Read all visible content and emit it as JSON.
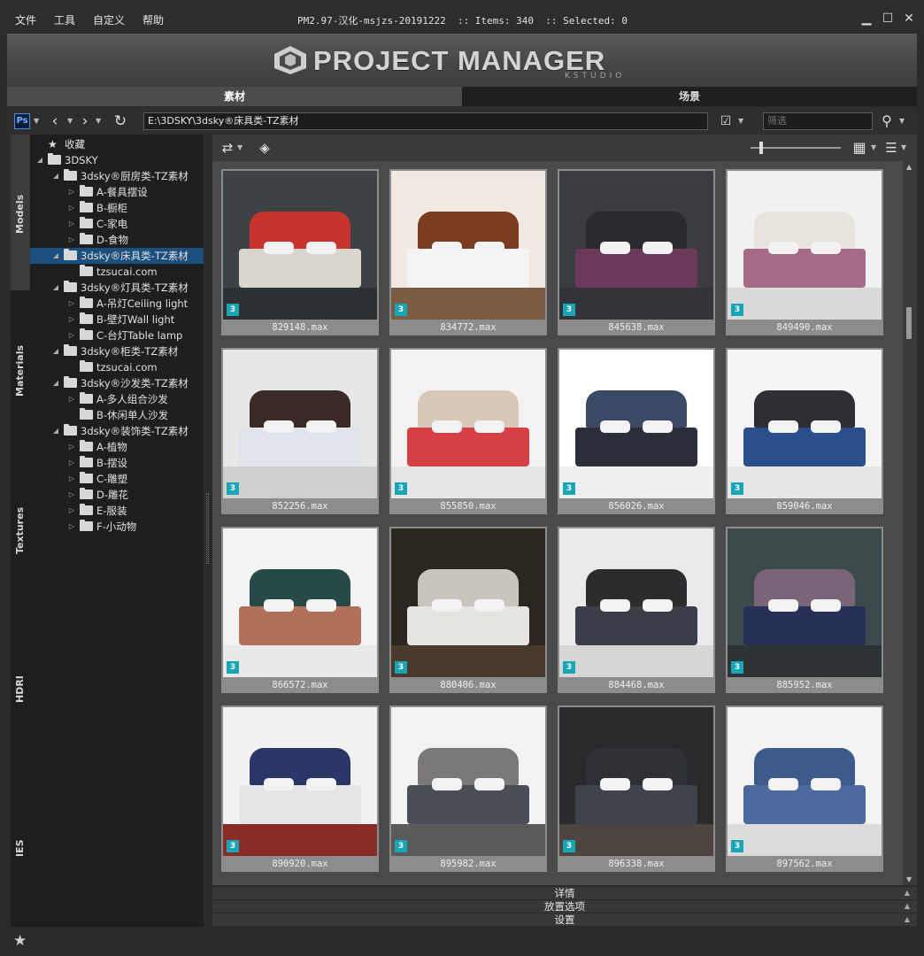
{
  "menu": [
    "文件",
    "工具",
    "自定义",
    "帮助"
  ],
  "title": "PM2.97-汉化-msjzs-20191222  :: Items: 340  :: Selected: 0",
  "logo": {
    "text": "PROJECT MANAGER",
    "sub": "KSTUDIO"
  },
  "main_tabs": [
    "素材",
    "场景"
  ],
  "toolbar": {
    "path": "E:\\3DSKY\\3dsky®床具类-TZ素材",
    "filter_placeholder": "筛选"
  },
  "side_tabs": [
    "Models",
    "Materials",
    "Textures",
    "HDRI",
    "IES"
  ],
  "tree": [
    {
      "label": "收藏",
      "level": 0,
      "tw": "",
      "star": true
    },
    {
      "label": "3DSKY",
      "level": 0,
      "tw": "◢"
    },
    {
      "label": "3dsky®厨房类-TZ素材",
      "level": 1,
      "tw": "◢"
    },
    {
      "label": "A-餐具摆设",
      "level": 2,
      "tw": "▷"
    },
    {
      "label": "B-橱柜",
      "level": 2,
      "tw": "▷"
    },
    {
      "label": "C-家电",
      "level": 2,
      "tw": "▷"
    },
    {
      "label": "D-食物",
      "level": 2,
      "tw": "▷"
    },
    {
      "label": "3dsky®床具类-TZ素材",
      "level": 1,
      "tw": "◢",
      "selected": true
    },
    {
      "label": "tzsucai.com",
      "level": 2,
      "tw": ""
    },
    {
      "label": "3dsky®灯具类-TZ素材",
      "level": 1,
      "tw": "◢"
    },
    {
      "label": "A-吊灯Ceiling light",
      "level": 2,
      "tw": "▷"
    },
    {
      "label": "B-壁灯Wall light",
      "level": 2,
      "tw": "▷"
    },
    {
      "label": "C-台灯Table lamp",
      "level": 2,
      "tw": "▷"
    },
    {
      "label": "3dsky®柜类-TZ素材",
      "level": 1,
      "tw": "◢"
    },
    {
      "label": "tzsucai.com",
      "level": 2,
      "tw": ""
    },
    {
      "label": "3dsky®沙发类-TZ素材",
      "level": 1,
      "tw": "◢"
    },
    {
      "label": "A-多人组合沙发",
      "level": 2,
      "tw": "▷"
    },
    {
      "label": "B-休闲单人沙发",
      "level": 2,
      "tw": ""
    },
    {
      "label": "3dsky®装饰类-TZ素材",
      "level": 1,
      "tw": "◢"
    },
    {
      "label": "A-植物",
      "level": 2,
      "tw": "▷"
    },
    {
      "label": "B-摆设",
      "level": 2,
      "tw": "▷"
    },
    {
      "label": "C-雕塑",
      "level": 2,
      "tw": "▷"
    },
    {
      "label": "D-雕花",
      "level": 2,
      "tw": "▷"
    },
    {
      "label": "E-服装",
      "level": 2,
      "tw": "▷"
    },
    {
      "label": "F-小动物",
      "level": 2,
      "tw": "▷"
    }
  ],
  "items": [
    {
      "file": "829148.max",
      "wall": "#3d4245",
      "head": "#c8332d",
      "bed": "#d9d4cc",
      "floor": "#2e3134"
    },
    {
      "file": "834772.max",
      "wall": "#efe9e2",
      "head": "#7a3b1f",
      "bed": "#f4f4f4",
      "floor": "#7a5b43"
    },
    {
      "file": "845638.max",
      "wall": "#3b3c40",
      "head": "#2a2a2e",
      "bed": "#6b3a5a",
      "floor": "#33343a"
    },
    {
      "file": "849490.max",
      "wall": "#f1f1f1",
      "head": "#e8e3dc",
      "bed": "#a56a86",
      "floor": "#dadada"
    },
    {
      "file": "852256.max",
      "wall": "#e7e7e7",
      "head": "#3b2b27",
      "bed": "#e0e4ea",
      "floor": "#cfcfcf"
    },
    {
      "file": "855850.max",
      "wall": "#f2f2f2",
      "head": "#d7c8b8",
      "bed": "#d64045",
      "floor": "#e6e6e6"
    },
    {
      "file": "856026.max",
      "wall": "#ffffff",
      "head": "#3a4a66",
      "bed": "#2c2f3a",
      "floor": "#efefef"
    },
    {
      "file": "859046.max",
      "wall": "#f4f4f4",
      "head": "#2f2f33",
      "bed": "#2b4f8c",
      "floor": "#e7e7e7"
    },
    {
      "file": "866572.max",
      "wall": "#f3f3f3",
      "head": "#274a47",
      "bed": "#b0705a",
      "floor": "#e9e9e9"
    },
    {
      "file": "880406.max",
      "wall": "#2c2620",
      "head": "#c9c4bd",
      "bed": "#e6e4e0",
      "floor": "#4a3a2c"
    },
    {
      "file": "884468.max",
      "wall": "#eaeaea",
      "head": "#2c2c2e",
      "bed": "#3a3e48",
      "floor": "#d6d6d6"
    },
    {
      "file": "885952.max",
      "wall": "#3c4a4c",
      "head": "#7a6578",
      "bed": "#273056",
      "floor": "#2e3436"
    },
    {
      "file": "890920.max",
      "wall": "#f1f1f1",
      "head": "#2b3566",
      "bed": "#e6e6e6",
      "floor": "#8b2b25"
    },
    {
      "file": "895982.max",
      "wall": "#f2f2f2",
      "head": "#7a7878",
      "bed": "#4b4d57",
      "floor": "#5a5a5a"
    },
    {
      "file": "896338.max",
      "wall": "#2a2a2c",
      "head": "#2f3136",
      "bed": "#3e424a",
      "floor": "#4e463e"
    },
    {
      "file": "897562.max",
      "wall": "#f3f3f3",
      "head": "#3c5b8a",
      "bed": "#4c6a9e",
      "floor": "#dcdcdc"
    }
  ],
  "panels": [
    "详情",
    "放置选项",
    "设置"
  ]
}
